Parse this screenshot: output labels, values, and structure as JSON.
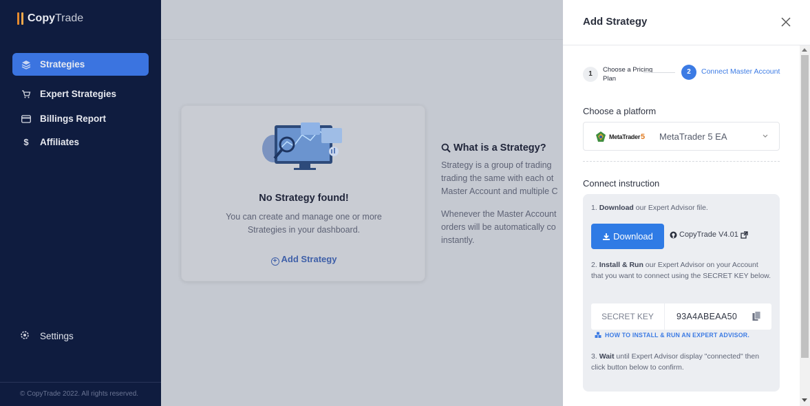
{
  "brand": {
    "name_bold": "Copy",
    "name_light": "Trade",
    "accent": "#e58a2e"
  },
  "sidebar": {
    "items": [
      {
        "label": "Strategies",
        "icon": "layers-icon",
        "active": true
      },
      {
        "label": "Expert Strategies",
        "icon": "cart-icon",
        "active": false
      },
      {
        "label": "Billings Report",
        "icon": "credit-card-icon",
        "active": false
      },
      {
        "label": "Affiliates",
        "icon": "dollar-icon",
        "active": false
      }
    ],
    "settings_label": "Settings",
    "copyright": "© CopyTrade 2022. All rights reserved."
  },
  "main": {
    "empty": {
      "title": "No Strategy found!",
      "subtitle": "You can create and manage one or more Strategies in your dashboard.",
      "add_label": "Add Strategy"
    },
    "info": {
      "title": "What is a Strategy?",
      "para1_lines": [
        "Strategy is a group of trading",
        "trading the same with each ot",
        "Master Account and multiple C"
      ],
      "para2_lines": [
        "Whenever the Master Account",
        "orders will be automatically co",
        "instantly."
      ]
    }
  },
  "drawer": {
    "title": "Add Strategy",
    "steps": [
      {
        "num": "1",
        "label": "Choose a Pricing Plan",
        "active": false
      },
      {
        "num": "2",
        "label": "Connect Master Account",
        "active": true
      }
    ],
    "platform_label": "Choose a platform",
    "platform": {
      "logo_text": "MetaTrader",
      "logo_num": "5",
      "value": "MetaTrader 5 EA"
    },
    "connect_label": "Connect instruction",
    "instructions": {
      "step1_bold": "Download",
      "step1_rest": " our Expert Advisor file.",
      "step1_prefix": "1. ",
      "download_label": "Download",
      "github_label": "CopyTrade V4.01",
      "step2_prefix": "2. ",
      "step2_bold": "Install & Run",
      "step2_rest": " our Expert Advisor on your Account that you want to connect using the SECRET KEY below.",
      "secret_label": "SECRET KEY",
      "secret_value": "93A4ABEAA50",
      "howto_label": "HOW TO INSTALL & RUN AN EXPERT ADVISOR.",
      "step3_prefix": "3. ",
      "step3_bold": "Wait",
      "step3_rest": " until Expert Advisor display \"connected\" then click button below to confirm."
    }
  },
  "colors": {
    "primary": "#3c7be4",
    "sidebar_bg": "#0f1c3f",
    "active_nav": "#3b74e0"
  }
}
